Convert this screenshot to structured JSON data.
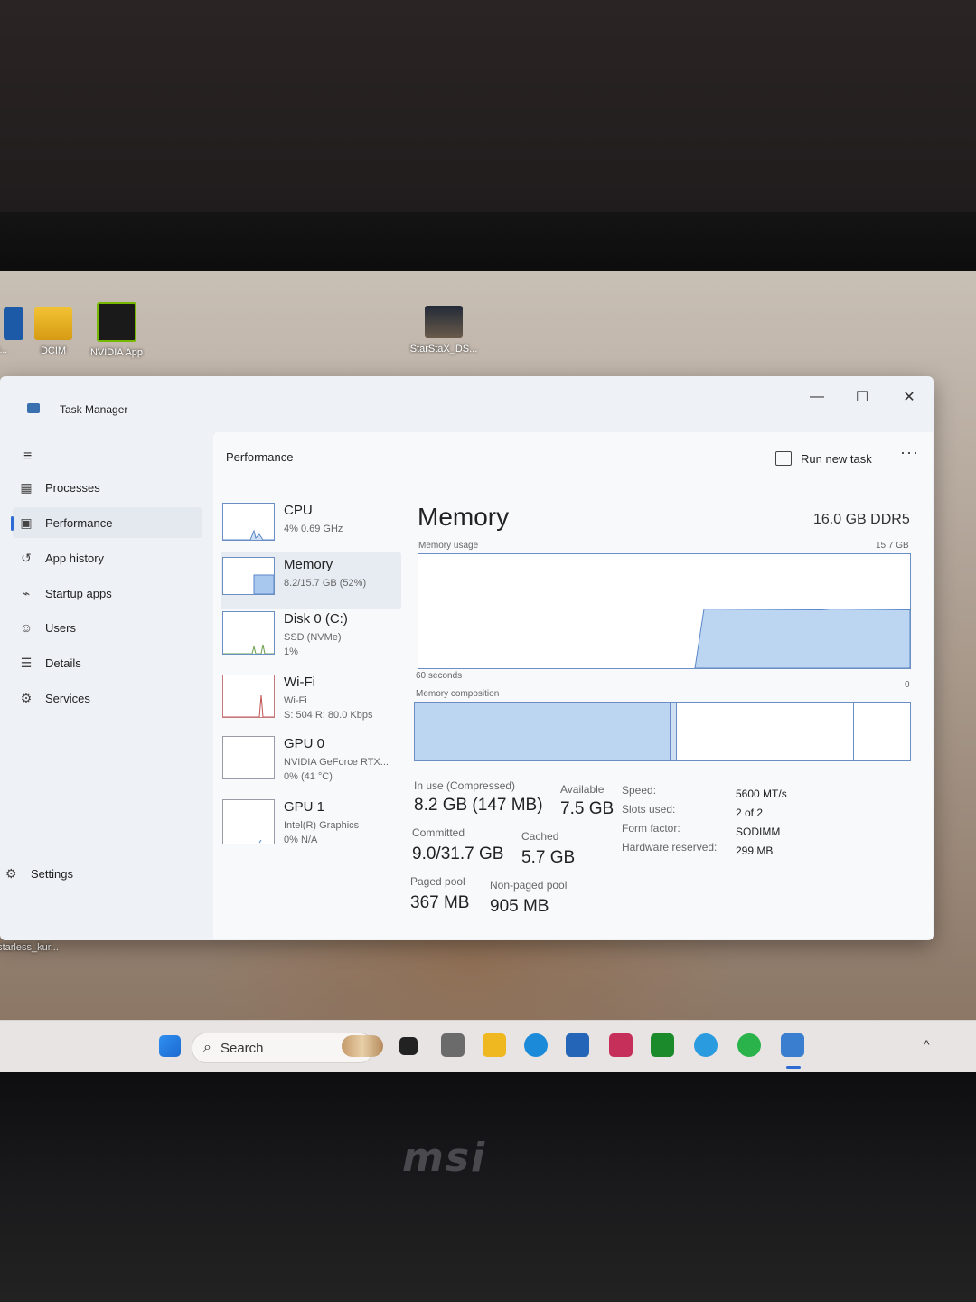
{
  "desktop": {
    "icons": [
      {
        "label": "e\nPr..."
      },
      {
        "label": "DCIM"
      },
      {
        "label": "NVIDIA App"
      },
      {
        "label": "StarStaX_DS..."
      },
      {
        "label": "starless_kur..."
      }
    ]
  },
  "window": {
    "title": "Task Manager",
    "minimize": "—",
    "maximize": "☐",
    "close": "✕"
  },
  "sidebar": {
    "menu_icon": "≡",
    "items": [
      {
        "label": "Processes",
        "icon": "processes-icon"
      },
      {
        "label": "Performance",
        "icon": "performance-icon"
      },
      {
        "label": "App history",
        "icon": "history-icon"
      },
      {
        "label": "Startup apps",
        "icon": "startup-icon"
      },
      {
        "label": "Users",
        "icon": "users-icon"
      },
      {
        "label": "Details",
        "icon": "details-icon"
      },
      {
        "label": "Services",
        "icon": "services-icon"
      }
    ],
    "settings": "Settings"
  },
  "header": {
    "title": "Performance",
    "run_new_task": "Run new task",
    "more": "···"
  },
  "devices": [
    {
      "name": "CPU",
      "sub1": "4%  0.69 GHz",
      "sub2": "",
      "sub3": ""
    },
    {
      "name": "Memory",
      "sub1": "8.2/15.7 GB (52%)",
      "sub2": "",
      "sub3": ""
    },
    {
      "name": "Disk 0 (C:)",
      "sub1": "SSD (NVMe)",
      "sub2": "1%",
      "sub3": ""
    },
    {
      "name": "Wi-Fi",
      "sub1": "Wi-Fi",
      "sub2": "S: 504  R: 80.0 Kbps",
      "sub3": ""
    },
    {
      "name": "GPU 0",
      "sub1": "NVIDIA GeForce RTX...",
      "sub2": "0%  (41 °C)",
      "sub3": ""
    },
    {
      "name": "GPU 1",
      "sub1": "Intel(R) Graphics",
      "sub2": "0%  N/A",
      "sub3": ""
    }
  ],
  "memory": {
    "title": "Memory",
    "spec": "16.0 GB DDR5",
    "usage_label": "Memory usage",
    "usage_max": "15.7 GB",
    "seconds_label": "60 seconds",
    "zero_label": "0",
    "composition_label": "Memory composition",
    "in_use_label": "In use (Compressed)",
    "in_use_value": "8.2 GB (147 MB)",
    "available_label": "Available",
    "available_value": "7.5 GB",
    "committed_label": "Committed",
    "committed_value": "9.0/31.7 GB",
    "cached_label": "Cached",
    "cached_value": "5.7 GB",
    "paged_label": "Paged pool",
    "paged_value": "367 MB",
    "nonpaged_label": "Non-paged pool",
    "nonpaged_value": "905 MB",
    "speed_label": "Speed:",
    "speed_value": "5600 MT/s",
    "slots_label": "Slots used:",
    "slots_value": "2 of 2",
    "form_label": "Form factor:",
    "form_value": "SODIMM",
    "hw_label": "Hardware reserved:",
    "hw_value": "299 MB",
    "usage_fraction": 0.52
  },
  "taskbar": {
    "search_placeholder": "Search"
  },
  "brand": "msi",
  "colors": {
    "accent": "#2f6bd5",
    "graph_fill": "#bcd6f2",
    "graph_border": "#6b8fc4"
  }
}
